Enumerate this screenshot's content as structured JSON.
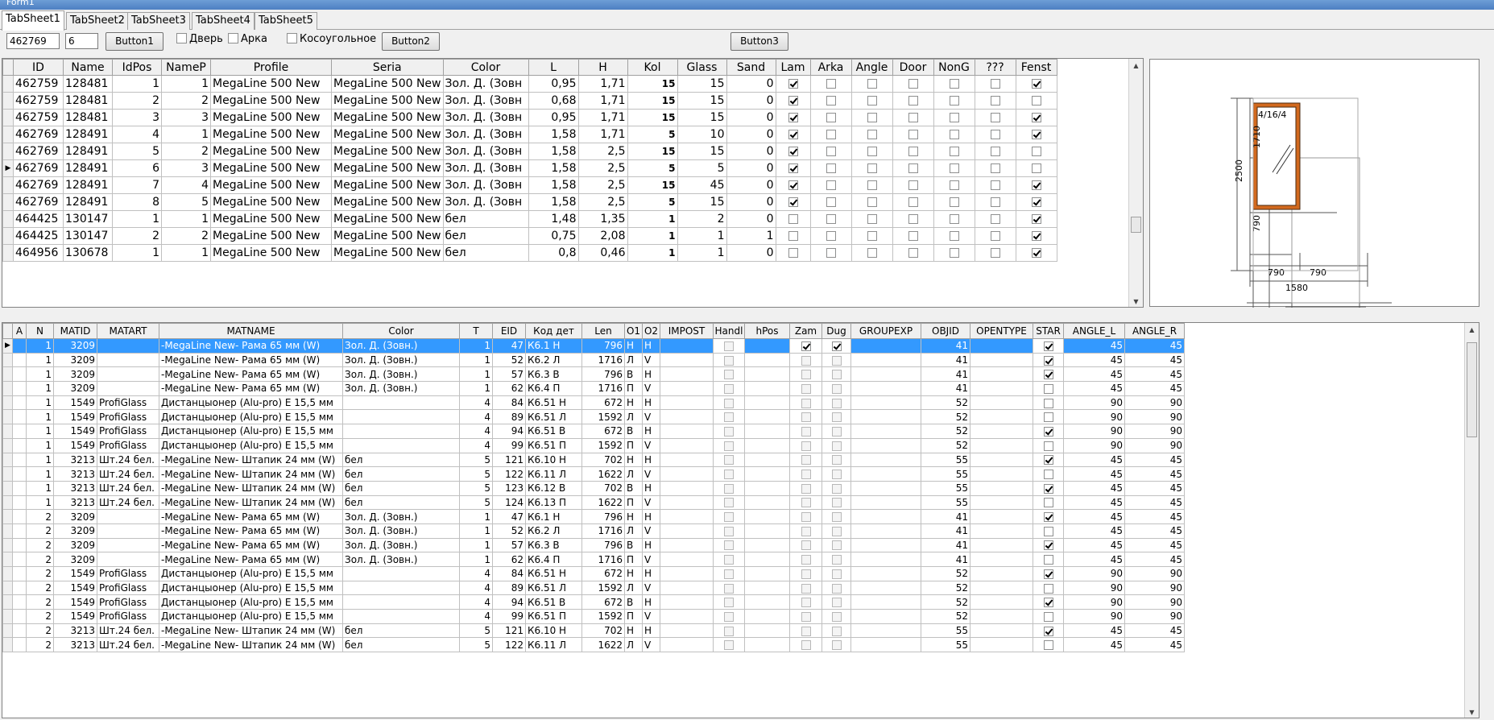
{
  "window": {
    "title": "Form1"
  },
  "tabs": [
    "TabSheet1",
    "TabSheet2",
    "TabSheet3",
    "TabSheet4",
    "TabSheet5"
  ],
  "toolbar": {
    "edit1": "462769",
    "edit2": "6",
    "button1": "Button1",
    "button2": "Button2",
    "button3": "Button3",
    "check_door": "Дверь",
    "check_arka": "Арка",
    "check_kosoug": "Косоугольное"
  },
  "grid1": {
    "columns": [
      "ID",
      "Name",
      "IdPos",
      "NameP",
      "Profile",
      "Seria",
      "Color",
      "L",
      "H",
      "Kol",
      "Glass",
      "Sand",
      "Lam",
      "Arka",
      "Angle",
      "Door",
      "NonG",
      "???",
      "Fenst"
    ],
    "current_row": 5,
    "rows": [
      [
        "462759",
        "128481",
        "1",
        "1",
        "MegaLine 500 New",
        "MegaLine 500 New",
        "Зол. Д. (Зовн",
        "0,95",
        "1,71",
        "15",
        "15",
        "0",
        true,
        false,
        false,
        false,
        false,
        false,
        true
      ],
      [
        "462759",
        "128481",
        "2",
        "2",
        "MegaLine 500 New",
        "MegaLine 500 New",
        "Зол. Д. (Зовн",
        "0,68",
        "1,71",
        "15",
        "15",
        "0",
        true,
        false,
        false,
        false,
        false,
        false,
        false
      ],
      [
        "462759",
        "128481",
        "3",
        "3",
        "MegaLine 500 New",
        "MegaLine 500 New",
        "Зол. Д. (Зовн",
        "0,95",
        "1,71",
        "15",
        "15",
        "0",
        true,
        false,
        false,
        false,
        false,
        false,
        true
      ],
      [
        "462769",
        "128491",
        "4",
        "1",
        "MegaLine 500 New",
        "MegaLine 500 New",
        "Зол. Д. (Зовн",
        "1,58",
        "1,71",
        "5",
        "10",
        "0",
        true,
        false,
        false,
        false,
        false,
        false,
        true
      ],
      [
        "462769",
        "128491",
        "5",
        "2",
        "MegaLine 500 New",
        "MegaLine 500 New",
        "Зол. Д. (Зовн",
        "1,58",
        "2,5",
        "15",
        "15",
        "0",
        true,
        false,
        false,
        false,
        false,
        false,
        false
      ],
      [
        "462769",
        "128491",
        "6",
        "3",
        "MegaLine 500 New",
        "MegaLine 500 New",
        "Зол. Д. (Зовн",
        "1,58",
        "2,5",
        "5",
        "5",
        "0",
        true,
        false,
        false,
        false,
        false,
        false,
        false
      ],
      [
        "462769",
        "128491",
        "7",
        "4",
        "MegaLine 500 New",
        "MegaLine 500 New",
        "Зол. Д. (Зовн",
        "1,58",
        "2,5",
        "15",
        "45",
        "0",
        true,
        false,
        false,
        false,
        false,
        false,
        true
      ],
      [
        "462769",
        "128491",
        "8",
        "5",
        "MegaLine 500 New",
        "MegaLine 500 New",
        "Зол. Д. (Зовн",
        "1,58",
        "2,5",
        "5",
        "15",
        "0",
        true,
        false,
        false,
        false,
        false,
        false,
        true
      ],
      [
        "464425",
        "130147",
        "1",
        "1",
        "MegaLine 500 New",
        "MegaLine 500 New",
        "бел",
        "1,48",
        "1,35",
        "1",
        "2",
        "0",
        false,
        false,
        false,
        false,
        false,
        false,
        true
      ],
      [
        "464425",
        "130147",
        "2",
        "2",
        "MegaLine 500 New",
        "MegaLine 500 New",
        "бел",
        "0,75",
        "2,08",
        "1",
        "1",
        "1",
        false,
        false,
        false,
        false,
        false,
        false,
        true
      ],
      [
        "464956",
        "130678",
        "1",
        "1",
        "MegaLine 500 New",
        "MegaLine 500 New",
        "бел",
        "0,8",
        "0,46",
        "1",
        "1",
        "0",
        false,
        false,
        false,
        false,
        false,
        false,
        true
      ]
    ]
  },
  "grid2": {
    "columns": [
      "A",
      "N",
      "MATID",
      "MATART",
      "MATNAME",
      "Color",
      "T",
      "EID",
      "Код дет",
      "Len",
      "O1",
      "O2",
      "IMPOST",
      "Handl",
      "hPos",
      "Zam",
      "Dug",
      "GROUPEXP",
      "OBJID",
      "OPENTYPE",
      "STAR",
      "ANGLE_L",
      "ANGLE_R"
    ],
    "selected_row": 0,
    "rows": [
      [
        "",
        "1",
        "3209",
        "",
        "-MegaLine New- Рама 65 мм (W)",
        "Зол. Д. (Зовн.)",
        "1",
        "47",
        "К6.1 Н",
        "796",
        "Н",
        "Н",
        "",
        false,
        "",
        true,
        true,
        "",
        "41",
        "",
        true,
        "45",
        "45"
      ],
      [
        "",
        "1",
        "3209",
        "",
        "-MegaLine New- Рама 65 мм (W)",
        "Зол. Д. (Зовн.)",
        "1",
        "52",
        "К6.2 Л",
        "1716",
        "Л",
        "V",
        "",
        false,
        "",
        false,
        false,
        "",
        "41",
        "",
        true,
        "45",
        "45"
      ],
      [
        "",
        "1",
        "3209",
        "",
        "-MegaLine New- Рама 65 мм (W)",
        "Зол. Д. (Зовн.)",
        "1",
        "57",
        "К6.3 В",
        "796",
        "В",
        "Н",
        "",
        false,
        "",
        false,
        false,
        "",
        "41",
        "",
        true,
        "45",
        "45"
      ],
      [
        "",
        "1",
        "3209",
        "",
        "-MegaLine New- Рама 65 мм (W)",
        "Зол. Д. (Зовн.)",
        "1",
        "62",
        "К6.4 П",
        "1716",
        "П",
        "V",
        "",
        false,
        "",
        false,
        false,
        "",
        "41",
        "",
        false,
        "45",
        "45"
      ],
      [
        "",
        "1",
        "1549",
        "ProfiGlass",
        "Дистанцыонер (Alu-pro) E 15,5 мм",
        "",
        "4",
        "84",
        "К6.51 Н",
        "672",
        "Н",
        "Н",
        "",
        false,
        "",
        false,
        false,
        "",
        "52",
        "",
        false,
        "90",
        "90"
      ],
      [
        "",
        "1",
        "1549",
        "ProfiGlass",
        "Дистанцыонер (Alu-pro) E 15,5 мм",
        "",
        "4",
        "89",
        "К6.51 Л",
        "1592",
        "Л",
        "V",
        "",
        false,
        "",
        false,
        false,
        "",
        "52",
        "",
        false,
        "90",
        "90"
      ],
      [
        "",
        "1",
        "1549",
        "ProfiGlass",
        "Дистанцыонер (Alu-pro) E 15,5 мм",
        "",
        "4",
        "94",
        "К6.51 В",
        "672",
        "В",
        "Н",
        "",
        false,
        "",
        false,
        false,
        "",
        "52",
        "",
        true,
        "90",
        "90"
      ],
      [
        "",
        "1",
        "1549",
        "ProfiGlass",
        "Дистанцыонер (Alu-pro) E 15,5 мм",
        "",
        "4",
        "99",
        "К6.51 П",
        "1592",
        "П",
        "V",
        "",
        false,
        "",
        false,
        false,
        "",
        "52",
        "",
        false,
        "90",
        "90"
      ],
      [
        "",
        "1",
        "3213",
        "Шт.24 бел.",
        "-MegaLine New- Штапик 24 мм (W)",
        "бел",
        "5",
        "121",
        "К6.10 Н",
        "702",
        "Н",
        "Н",
        "",
        false,
        "",
        false,
        false,
        "",
        "55",
        "",
        true,
        "45",
        "45"
      ],
      [
        "",
        "1",
        "3213",
        "Шт.24 бел.",
        "-MegaLine New- Штапик 24 мм (W)",
        "бел",
        "5",
        "122",
        "К6.11 Л",
        "1622",
        "Л",
        "V",
        "",
        false,
        "",
        false,
        false,
        "",
        "55",
        "",
        false,
        "45",
        "45"
      ],
      [
        "",
        "1",
        "3213",
        "Шт.24 бел.",
        "-MegaLine New- Штапик 24 мм (W)",
        "бел",
        "5",
        "123",
        "К6.12 В",
        "702",
        "В",
        "Н",
        "",
        false,
        "",
        false,
        false,
        "",
        "55",
        "",
        true,
        "45",
        "45"
      ],
      [
        "",
        "1",
        "3213",
        "Шт.24 бел.",
        "-MegaLine New- Штапик 24 мм (W)",
        "бел",
        "5",
        "124",
        "К6.13 П",
        "1622",
        "П",
        "V",
        "",
        false,
        "",
        false,
        false,
        "",
        "55",
        "",
        false,
        "45",
        "45"
      ],
      [
        "",
        "2",
        "3209",
        "",
        "-MegaLine New- Рама 65 мм (W)",
        "Зол. Д. (Зовн.)",
        "1",
        "47",
        "К6.1 Н",
        "796",
        "Н",
        "Н",
        "",
        false,
        "",
        false,
        false,
        "",
        "41",
        "",
        true,
        "45",
        "45"
      ],
      [
        "",
        "2",
        "3209",
        "",
        "-MegaLine New- Рама 65 мм (W)",
        "Зол. Д. (Зовн.)",
        "1",
        "52",
        "К6.2 Л",
        "1716",
        "Л",
        "V",
        "",
        false,
        "",
        false,
        false,
        "",
        "41",
        "",
        false,
        "45",
        "45"
      ],
      [
        "",
        "2",
        "3209",
        "",
        "-MegaLine New- Рама 65 мм (W)",
        "Зол. Д. (Зовн.)",
        "1",
        "57",
        "К6.3 В",
        "796",
        "В",
        "Н",
        "",
        false,
        "",
        false,
        false,
        "",
        "41",
        "",
        true,
        "45",
        "45"
      ],
      [
        "",
        "2",
        "3209",
        "",
        "-MegaLine New- Рама 65 мм (W)",
        "Зол. Д. (Зовн.)",
        "1",
        "62",
        "К6.4 П",
        "1716",
        "П",
        "V",
        "",
        false,
        "",
        false,
        false,
        "",
        "41",
        "",
        false,
        "45",
        "45"
      ],
      [
        "",
        "2",
        "1549",
        "ProfiGlass",
        "Дистанцыонер (Alu-pro) E 15,5 мм",
        "",
        "4",
        "84",
        "К6.51 Н",
        "672",
        "Н",
        "Н",
        "",
        false,
        "",
        false,
        false,
        "",
        "52",
        "",
        true,
        "90",
        "90"
      ],
      [
        "",
        "2",
        "1549",
        "ProfiGlass",
        "Дистанцыонер (Alu-pro) E 15,5 мм",
        "",
        "4",
        "89",
        "К6.51 Л",
        "1592",
        "Л",
        "V",
        "",
        false,
        "",
        false,
        false,
        "",
        "52",
        "",
        false,
        "90",
        "90"
      ],
      [
        "",
        "2",
        "1549",
        "ProfiGlass",
        "Дистанцыонер (Alu-pro) E 15,5 мм",
        "",
        "4",
        "94",
        "К6.51 В",
        "672",
        "В",
        "Н",
        "",
        false,
        "",
        false,
        false,
        "",
        "52",
        "",
        true,
        "90",
        "90"
      ],
      [
        "",
        "2",
        "1549",
        "ProfiGlass",
        "Дистанцыонер (Alu-pro) E 15,5 мм",
        "",
        "4",
        "99",
        "К6.51 П",
        "1592",
        "П",
        "V",
        "",
        false,
        "",
        false,
        false,
        "",
        "52",
        "",
        false,
        "90",
        "90"
      ],
      [
        "",
        "2",
        "3213",
        "Шт.24 бел.",
        "-MegaLine New- Штапик 24 мм (W)",
        "бел",
        "5",
        "121",
        "К6.10 Н",
        "702",
        "Н",
        "Н",
        "",
        false,
        "",
        false,
        false,
        "",
        "55",
        "",
        true,
        "45",
        "45"
      ],
      [
        "",
        "2",
        "3213",
        "Шт.24 бел.",
        "-MegaLine New- Штапик 24 мм (W)",
        "бел",
        "5",
        "122",
        "К6.11 Л",
        "1622",
        "Л",
        "V",
        "",
        false,
        "",
        false,
        false,
        "",
        "55",
        "",
        false,
        "45",
        "45"
      ]
    ]
  },
  "preview": {
    "glass_label": "4/16/4",
    "dim_total_height": "2500",
    "dim_upper_height": "1710",
    "dim_lower_height": "790",
    "dim_left_width": "790",
    "dim_right_width": "790",
    "dim_total_width": "1580",
    "frame_color": "#d2691e"
  },
  "colors": {
    "selection": "#3399ff",
    "tab_active": "#ffffff"
  }
}
